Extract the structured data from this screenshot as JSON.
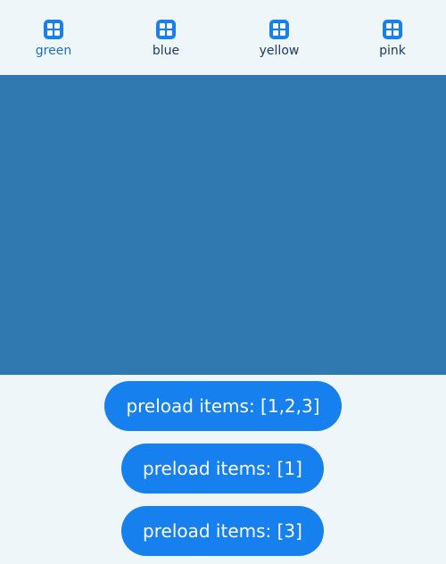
{
  "tabs": [
    {
      "label": "green",
      "active": true,
      "icon": "app-grid-icon"
    },
    {
      "label": "blue",
      "active": false,
      "icon": "app-grid-icon"
    },
    {
      "label": "yellow",
      "active": false,
      "icon": "app-grid-icon"
    },
    {
      "label": "pink",
      "active": false,
      "icon": "app-grid-icon"
    }
  ],
  "colors": {
    "background": "#eef6f9",
    "content_panel": "#2f79b0",
    "accent": "#1780ef",
    "tab_active": "#1c6fc0",
    "tab_inactive": "#1f3b63"
  },
  "buttons": {
    "preload_all_label": "preload items: [1,2,3]",
    "preload_one_label": "preload items: [1]",
    "preload_three_label": "preload items: [3]"
  }
}
